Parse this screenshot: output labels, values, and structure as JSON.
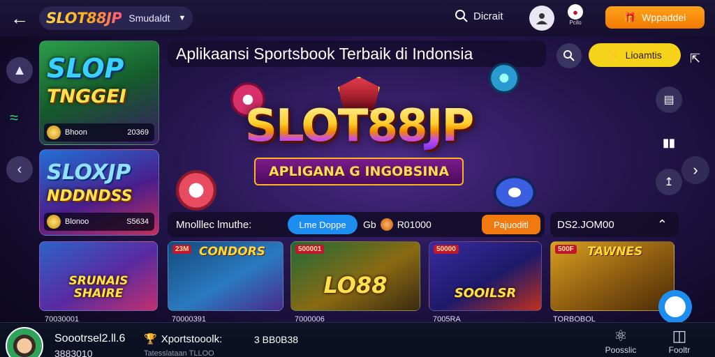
{
  "topbar": {
    "logo": "SLOT88JP",
    "brand_sub": "Smudaldt",
    "search_label": "Dicrait",
    "mascot_label": "Pcilo",
    "promo_label": "Wppaddei"
  },
  "hero": {
    "title": "Aplikaansi Sportsbook Terbaik di Indonsia",
    "pill_label": "Lioamtis",
    "logo_text": "SLOT88JP",
    "ribbon_text": "APLIGANA G INGOBSINA"
  },
  "cards": [
    {
      "title1": "SLOP",
      "title2": "TNGGEI",
      "foot_left": "Bhoon",
      "foot_right": "20369"
    },
    {
      "title1": "SLOXJP",
      "title2": "NDDNDSS",
      "foot_left": "Blonoo",
      "foot_right": "S5634"
    }
  ],
  "filter": {
    "label": "Mnolllec lmuthe:",
    "blue_pill": "Lme Doppe",
    "gb_text": "Gb",
    "gb_value": "R01000",
    "orange_pill": "Pajuoditl",
    "amount": "DS2.JOM00"
  },
  "thumbs": [
    {
      "title": "SRUNAIS SHAIRE",
      "top": "",
      "tag": "",
      "caption": "70030001"
    },
    {
      "title": "",
      "top": "CONDORS",
      "tag": "23M",
      "caption": "70000391"
    },
    {
      "title": "LO88",
      "top": "",
      "tag": "500001",
      "caption": "7000006"
    },
    {
      "title": "SOOILSR",
      "top": "",
      "tag": "50000",
      "caption": "7005RA"
    },
    {
      "title": "",
      "top": "TAWNES",
      "tag": "500F",
      "caption": "TORBOBOL"
    }
  ],
  "bottom": {
    "name": "Soootrsel2.ll.6",
    "sub": "3883010",
    "mid_label": "Xportstooolk:",
    "mid_sub": "Tatesslataan TLLOO",
    "amount": "3 BB0B38",
    "nav1": "Poosslic",
    "nav2": "Fooltr"
  },
  "colors": {
    "accent_orange": "#f07a10",
    "accent_blue": "#1e8df0",
    "accent_yellow": "#f4d31a"
  }
}
